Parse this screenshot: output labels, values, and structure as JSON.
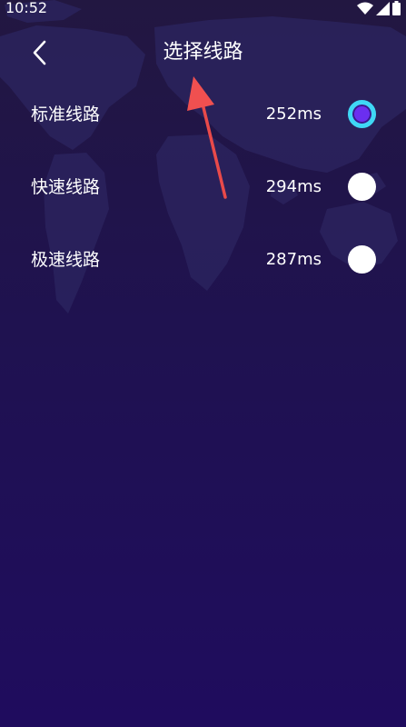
{
  "status_bar": {
    "time": "10:52",
    "icons": [
      "wifi-icon",
      "cellular-signal-icon",
      "battery-icon"
    ]
  },
  "header": {
    "title": "选择线路",
    "back_icon": "chevron-left-icon"
  },
  "routes": [
    {
      "name": "标准线路",
      "latency": "252ms",
      "selected": true
    },
    {
      "name": "快速线路",
      "latency": "294ms",
      "selected": false
    },
    {
      "name": "极速线路",
      "latency": "287ms",
      "selected": false
    }
  ],
  "colors": {
    "background_top": "#221741",
    "background_bottom": "#1f0c5e",
    "text": "#ffffff",
    "radio_selected_ring": "#3fd7f5",
    "radio_selected_fill": "#6b2ff0",
    "radio_unselected": "#ffffff",
    "annotation_arrow": "#f04a4a"
  }
}
